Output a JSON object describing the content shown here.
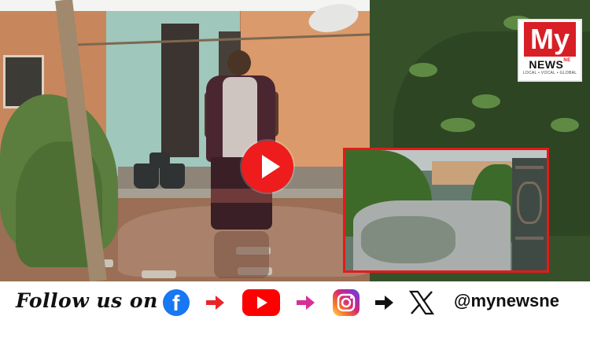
{
  "video": {
    "logo": {
      "top": "My",
      "middle": "NEWS",
      "badge": "NE",
      "tagline": "LOCAL • VOCAL • GLOBAL"
    },
    "play_icon": "play-button-icon",
    "accent_color": "#ee1c1c"
  },
  "follow_bar": {
    "text": "Follow us on",
    "handle": "@mynewsne",
    "icons": [
      "facebook-icon",
      "arrow-right-icon",
      "youtube-icon",
      "arrow-right-icon",
      "instagram-icon",
      "arrow-right-icon",
      "x-icon"
    ],
    "colors": {
      "facebook": "#1877f2",
      "youtube": "#ff0000",
      "arrow_1": "#e8262a",
      "arrow_2": "#d62f95",
      "arrow_3": "#111111"
    }
  }
}
